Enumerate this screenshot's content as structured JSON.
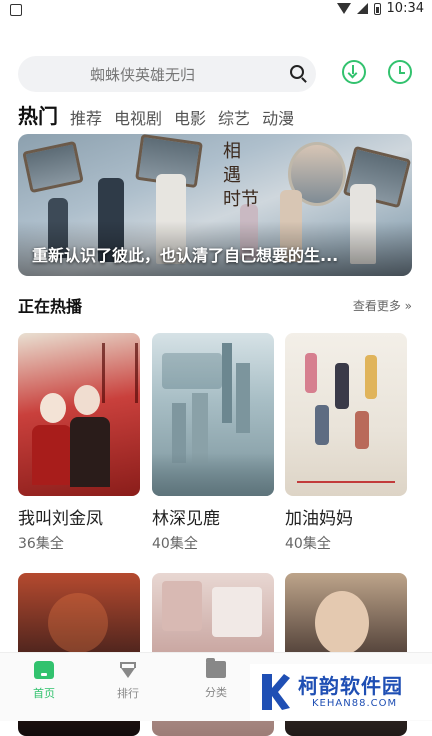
{
  "status_bar": {
    "time": "10:34"
  },
  "search": {
    "placeholder": "蜘蛛侠英雄无归"
  },
  "tabs": [
    {
      "label": "热门",
      "active": true
    },
    {
      "label": "推荐"
    },
    {
      "label": "电视剧"
    },
    {
      "label": "电影"
    },
    {
      "label": "综艺"
    },
    {
      "label": "动漫"
    }
  ],
  "banner": {
    "caption": "重新认识了彼此，也认清了自己想要的生..."
  },
  "now_playing": {
    "title": "正在热播",
    "see_more": "查看更多 »",
    "cards": [
      {
        "title": "我叫刘金凤",
        "episodes": "36集全"
      },
      {
        "title": "林深见鹿",
        "episodes": "40集全"
      },
      {
        "title": "加油妈妈",
        "episodes": "40集全"
      }
    ]
  },
  "bottom_nav": {
    "items": [
      {
        "label": "首页",
        "active": true
      },
      {
        "label": "排行"
      },
      {
        "label": "分类"
      }
    ]
  },
  "watermark": {
    "text": "柯韵软件园",
    "url": "KEHAN88.COM"
  },
  "colors": {
    "accent": "#32c26e",
    "watermark": "#1f4fb4"
  }
}
